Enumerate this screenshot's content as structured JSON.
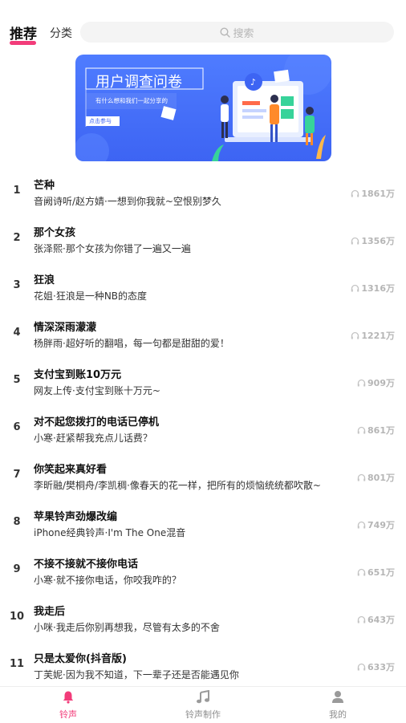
{
  "header": {
    "tab_recommend": "推荐",
    "tab_category": "分类",
    "search_placeholder": "搜索"
  },
  "banner": {
    "title": "用户调查问卷",
    "subtitle": "有什么想和我们一起分享的",
    "button": "点击参与"
  },
  "songs": [
    {
      "rank": "1",
      "title": "芒种",
      "desc": "音阙诗听/赵方婧·一想到你我就~空恨别梦久",
      "plays": "1861万"
    },
    {
      "rank": "2",
      "title": "那个女孩",
      "desc": "张泽熙·那个女孩为你错了一遍又一遍",
      "plays": "1356万"
    },
    {
      "rank": "3",
      "title": "狂浪",
      "desc": "花姐·狂浪是一种NB的态度",
      "plays": "1316万"
    },
    {
      "rank": "4",
      "title": "情深深雨濛濛",
      "desc": "杨胖雨·超好听的翻唱，每一句都是甜甜的爱！",
      "plays": "1221万"
    },
    {
      "rank": "5",
      "title": "支付宝到账10万元",
      "desc": "网友上传·支付宝到账十万元~",
      "plays": "909万"
    },
    {
      "rank": "6",
      "title": "对不起您拨打的电话已停机",
      "desc": "小寒·赶紧帮我充点儿话费？",
      "plays": "861万"
    },
    {
      "rank": "7",
      "title": "你笑起来真好看",
      "desc": "李昕融/樊桐舟/李凯稠·像春天的花一样，把所有的烦恼统统都吹散~",
      "plays": "801万"
    },
    {
      "rank": "8",
      "title": "苹果铃声劲爆改编",
      "desc": "iPhone经典铃声·I'm The One混音",
      "plays": "749万"
    },
    {
      "rank": "9",
      "title": "不接不接就不接你电话",
      "desc": "小寒·就不接你电话，你咬我咋的？",
      "plays": "651万"
    },
    {
      "rank": "10",
      "title": "我走后",
      "desc": "小咪·我走后你别再想我，尽管有太多的不舍",
      "plays": "643万"
    },
    {
      "rank": "11",
      "title": "只是太爱你(抖音版)",
      "desc": "丁芙妮·因为我不知道，下一辈子还是否能遇见你",
      "plays": "633万"
    }
  ],
  "nav": {
    "ringtone": "铃声",
    "make": "铃声制作",
    "mine": "我的"
  },
  "colors": {
    "accent": "#f23c7a",
    "banner_blue": "#4a74fb",
    "muted": "#b5b5b5"
  }
}
